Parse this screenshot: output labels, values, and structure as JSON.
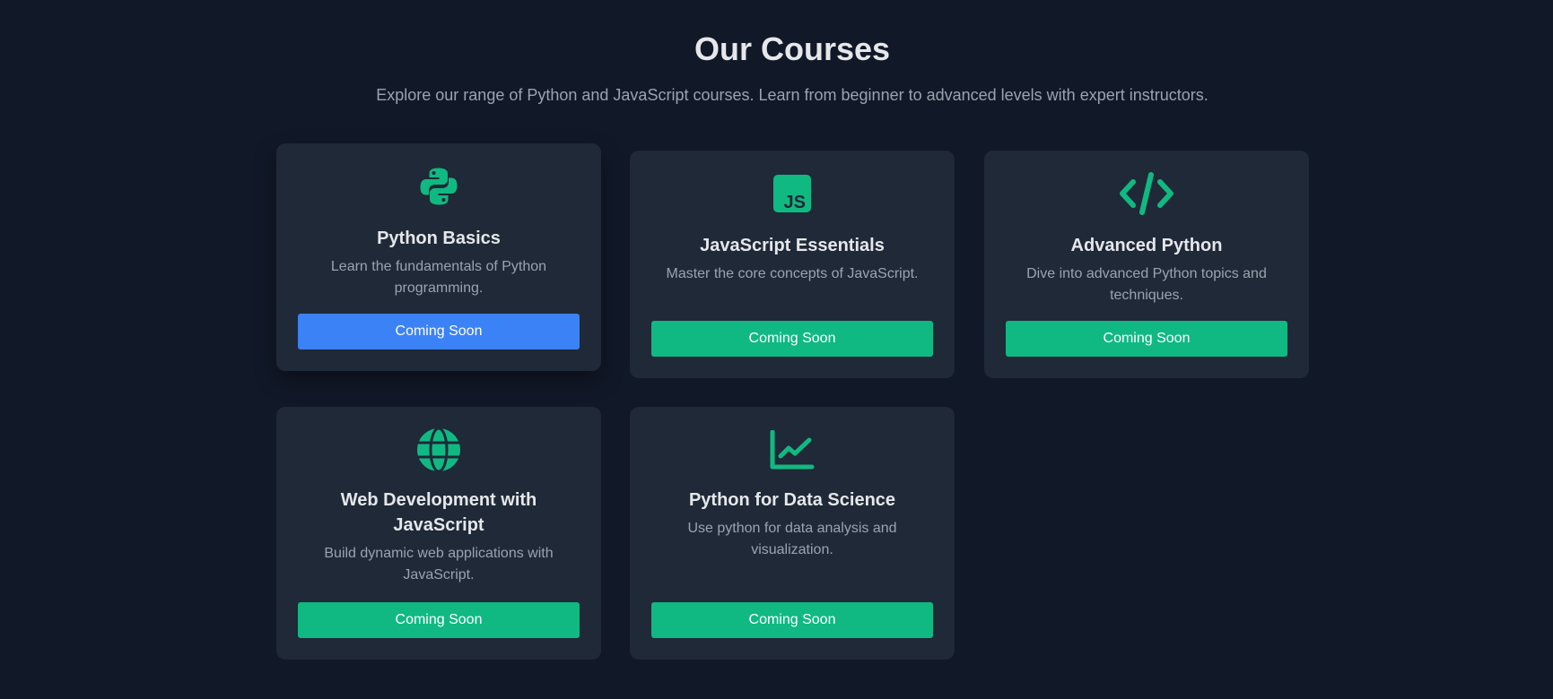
{
  "header": {
    "title": "Our Courses",
    "subtitle": "Explore our range of Python and JavaScript courses. Learn from beginner to advanced levels with expert instructors."
  },
  "colors": {
    "background": "#111827",
    "card": "#1f2937",
    "accent_green": "#10b981",
    "accent_blue": "#3b82f6"
  },
  "courses": [
    {
      "icon": "python-icon",
      "title": "Python Basics",
      "description": "Learn the fundamentals of Python programming.",
      "button_label": "Coming Soon"
    },
    {
      "icon": "javascript-icon",
      "title": "JavaScript Essentials",
      "description": "Master the core concepts of JavaScript.",
      "button_label": "Coming Soon"
    },
    {
      "icon": "code-icon",
      "title": "Advanced Python",
      "description": "Dive into advanced Python topics and techniques.",
      "button_label": "Coming Soon"
    },
    {
      "icon": "globe-icon",
      "title": "Web Development with JavaScript",
      "description": "Build dynamic web applications with JavaScript.",
      "button_label": "Coming Soon"
    },
    {
      "icon": "chart-line-icon",
      "title": "Python for Data Science",
      "description": "Use python for data analysis and visualization.",
      "button_label": "Coming Soon"
    }
  ]
}
